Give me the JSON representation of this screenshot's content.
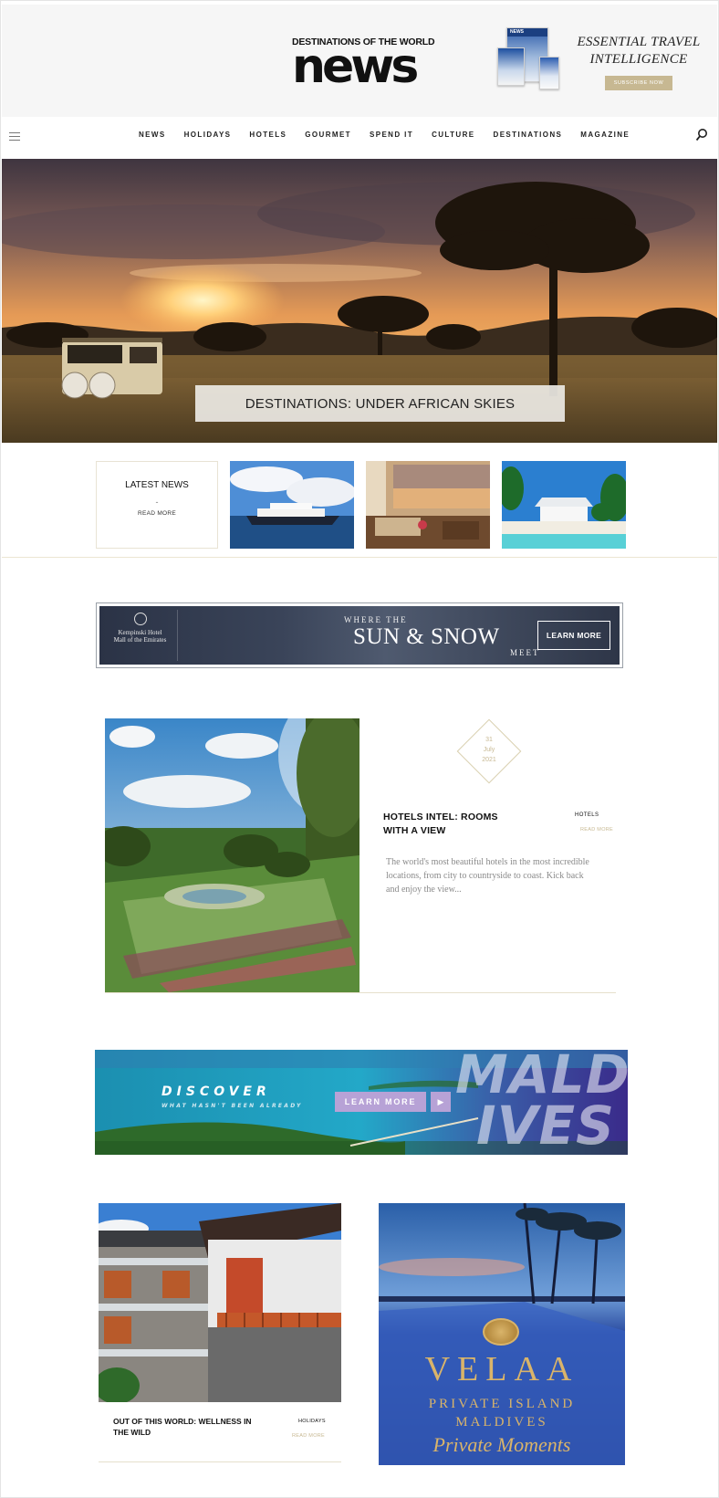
{
  "header": {
    "logo_kicker": "DESTINATIONS OF THE WORLD",
    "logo_word": "news",
    "promo_line1": "ESSENTIAL TRAVEL",
    "promo_line2": "INTELLIGENCE",
    "promo_button": "SUBSCRIBE NOW",
    "magazine_cover_label": "NEWS"
  },
  "nav": {
    "items": [
      "NEWS",
      "HOLIDAYS",
      "HOTELS",
      "GOURMET",
      "SPEND IT",
      "CULTURE",
      "DESTINATIONS",
      "MAGAZINE"
    ],
    "menu_icon": "hamburger-icon",
    "search_icon": "search-icon"
  },
  "hero": {
    "caption": "DESTINATIONS: UNDER AFRICAN SKIES"
  },
  "latest": {
    "title": "LATEST NEWS",
    "dash": "-",
    "read_more": "READ MORE"
  },
  "banner1": {
    "hotel_line1": "Kempinski Hotel",
    "hotel_line2": "Mall of the Emirates",
    "top": "WHERE THE",
    "main": "SUN & SNOW",
    "bottom": "MEET",
    "button": "LEARN MORE"
  },
  "feature": {
    "date_day": "31",
    "date_month": "July",
    "date_year": "2021",
    "title": "HOTELS INTEL: ROOMS WITH A VIEW",
    "category": "HOTELS",
    "read_more": "READ MORE",
    "excerpt": "The world's most beautiful hotels in the most incredible locations, from city to countryside to coast. Kick back and enjoy the view..."
  },
  "banner2": {
    "discover": "DISCOVER",
    "sub": "WHAT HASN'T BEEN ALREADY",
    "button": "LEARN MORE",
    "arrow": "▶",
    "word_top": "MALD",
    "word_bottom": "IVES"
  },
  "card2": {
    "title": "OUT OF THIS WORLD: WELLNESS IN THE WILD",
    "category": "HOLIDAYS",
    "read_more": "READ MORE"
  },
  "velaa": {
    "name": "VELAA",
    "line1": "PRIVATE ISLAND",
    "line2": "MALDIVES",
    "line3": "Private Moments"
  },
  "colors": {
    "gold": "#c7b892",
    "header_bg": "#f6f6f6"
  }
}
